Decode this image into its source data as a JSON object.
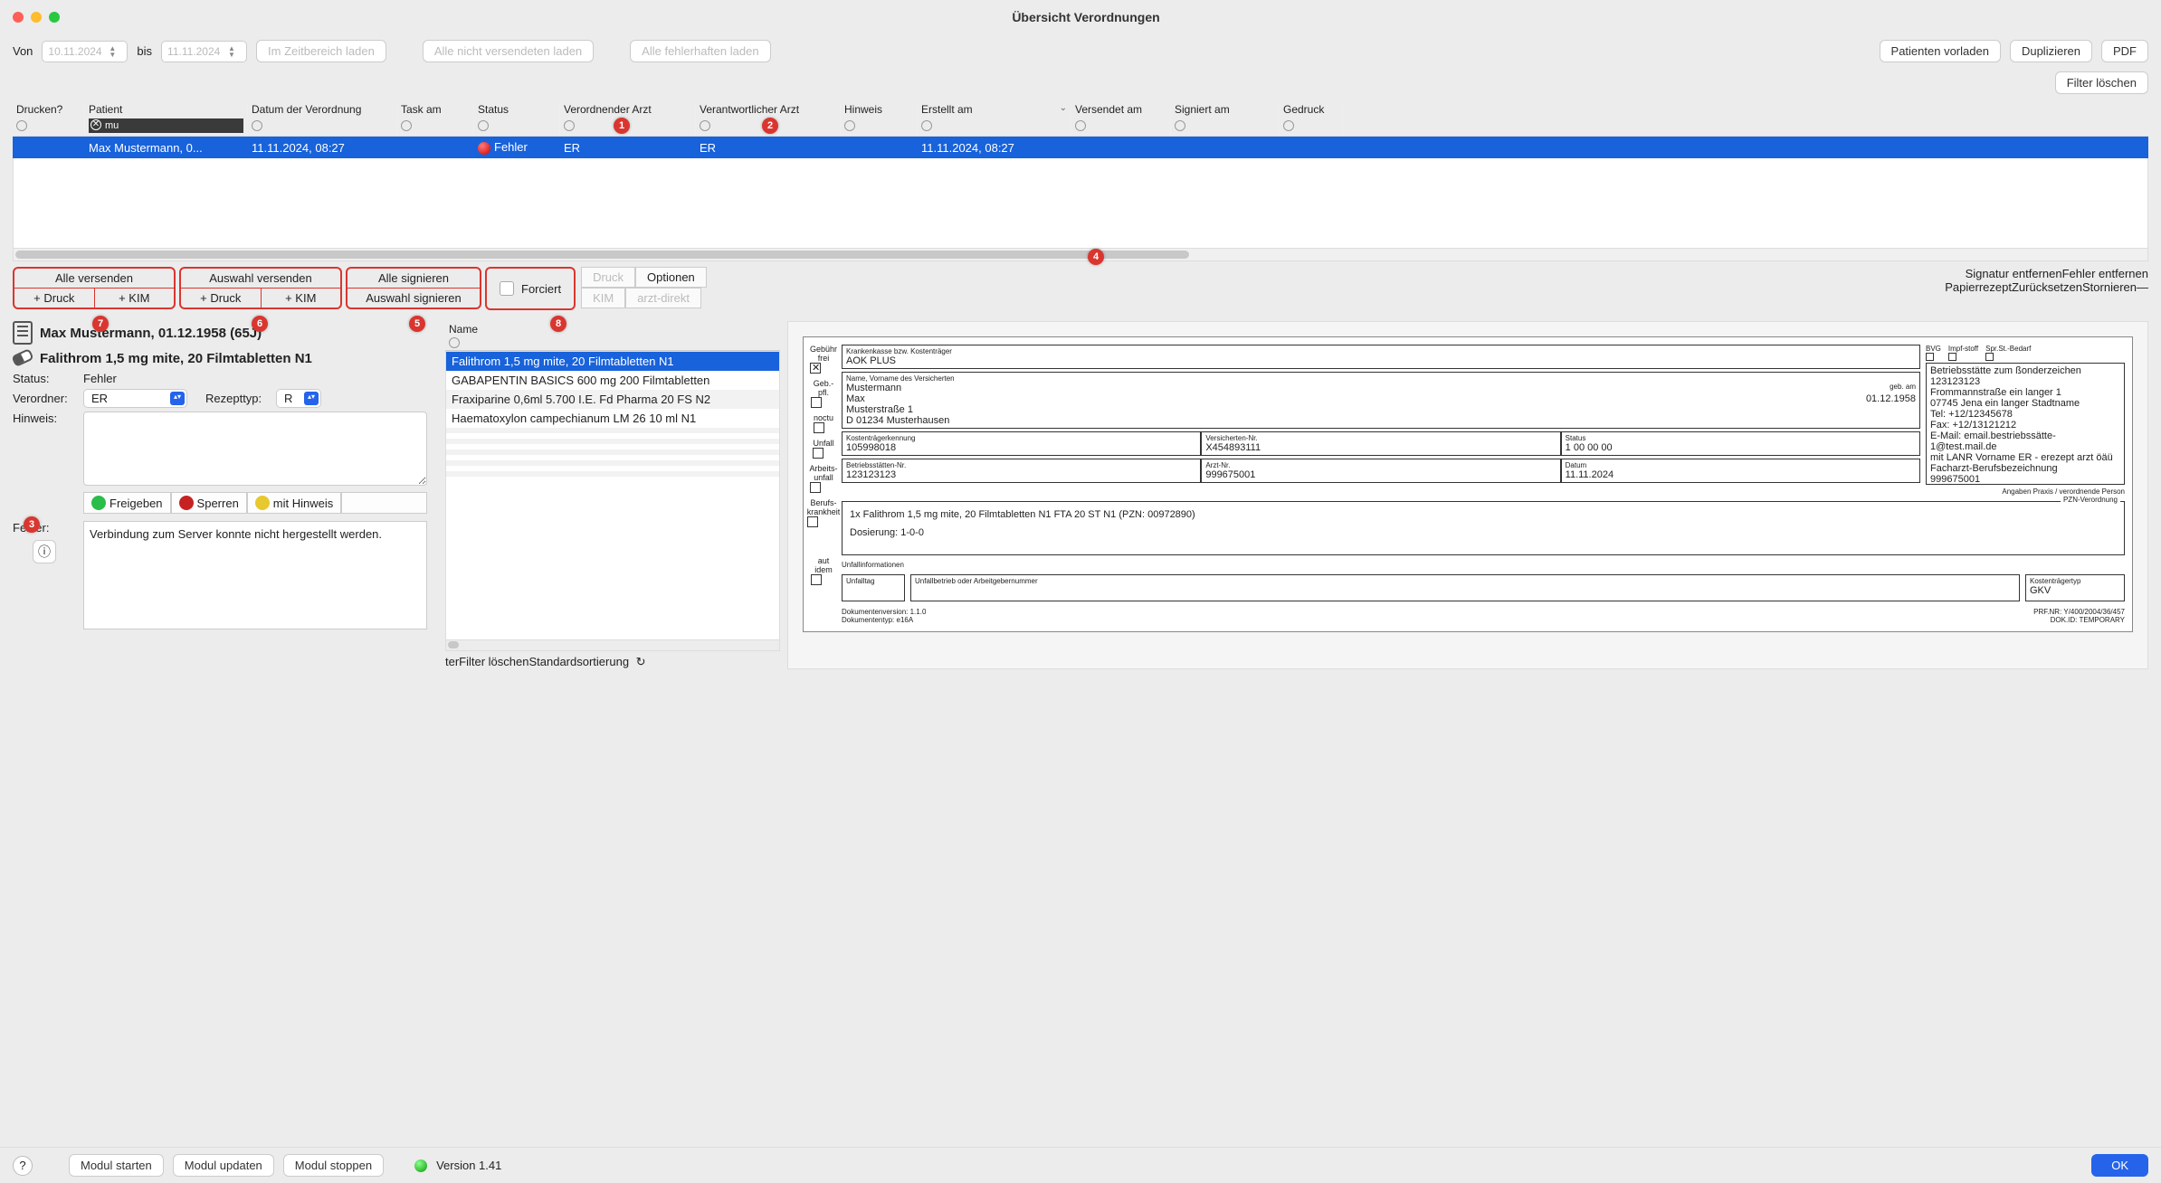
{
  "window": {
    "title": "Übersicht Verordnungen"
  },
  "toolbar": {
    "from_label": "Von",
    "from_value": "10.11.2024",
    "to_label": "bis",
    "to_value": "11.11.2024",
    "load_range": "Im Zeitbereich laden",
    "load_unsent": "Alle nicht versendeten laden",
    "load_errors": "Alle fehlerhaften laden",
    "preload_patients": "Patienten vorladen",
    "duplicate": "Duplizieren",
    "pdf": "PDF",
    "clear_filter": "Filter löschen"
  },
  "callouts": {
    "c1": "1",
    "c2": "2",
    "c3": "3",
    "c4": "4",
    "c5": "5",
    "c6": "6",
    "c7": "7",
    "c8": "8"
  },
  "table": {
    "columns": {
      "print": "Drucken?",
      "patient": "Patient",
      "rx_date": "Datum der Verordnung",
      "task_on": "Task am",
      "status": "Status",
      "prescriber": "Verordnender Arzt",
      "responsible": "Verantwortlicher Arzt",
      "note": "Hinweis",
      "created": "Erstellt am",
      "sent": "Versendet am",
      "signed": "Signiert am",
      "printed": "Gedruck"
    },
    "filter_patient": "mu",
    "row": {
      "patient": "Max Mustermann, 0...",
      "rx_date": "11.11.2024, 08:27",
      "status": "Fehler",
      "prescriber": "ER",
      "responsible": "ER",
      "created": "11.11.2024, 08:27"
    }
  },
  "actions": {
    "send_all": "Alle versenden",
    "send_selection": "Auswahl versenden",
    "sign_all": "Alle signieren",
    "sign_selection": "Auswahl signieren",
    "plus_print": "+ Druck",
    "plus_kim": "+ KIM",
    "forced": "Forciert",
    "print": "Druck",
    "options": "Optionen",
    "kim": "KIM",
    "arzt_direkt": "arzt-direkt",
    "remove_sig": "Signatur entfernen",
    "remove_err": "Fehler entfernen",
    "paper_rx": "Papierrezept",
    "reset": "Zurücksetzen",
    "cancel": "Stornieren",
    "minus": "—"
  },
  "detail": {
    "patient_title": "Max Mustermann, 01.12.1958 (65J)",
    "medication_title": "Falithrom 1,5 mg mite, 20 Filmtabletten N1",
    "status_label": "Status:",
    "status_value": "Fehler",
    "prescriber_label": "Verordner:",
    "prescriber_value": "ER",
    "rx_type_label": "Rezepttyp:",
    "rx_type_value": "R",
    "note_label": "Hinweis:",
    "release": "Freigeben",
    "block": "Sperren",
    "with_note": "mit Hinweis",
    "error_label": "Fehler:",
    "error_text": "Verbindung zum Server konnte nicht hergestellt werden."
  },
  "namelist": {
    "header": "Name",
    "footer_ter": "ter",
    "footer_clear": "Filter löschen",
    "footer_sort": "Standardsortierung",
    "items": [
      "Falithrom 1,5 mg mite, 20 Filmtabletten N1",
      "GABAPENTIN BASICS 600 mg 200 Filmtabletten",
      "Fraxiparine 0,6ml 5.700 I.E. Fd Pharma 20 FS N2",
      "Haematoxylon campechianum LM 26 10 ml N1"
    ]
  },
  "rx": {
    "left_labels": {
      "gebuhr": "Gebühr frei",
      "gebpfl": "Geb.-pfl.",
      "noctu": "noctu",
      "unfall": "Unfall",
      "arbeits": "Arbeits-unfall",
      "berufs": "Berufs-krankheit",
      "aut_idem": "aut idem"
    },
    "kk_lbl": "Krankenkasse bzw. Kostenträger",
    "kk_val": "AOK PLUS",
    "name_lbl": "Name, Vorname des Versicherten",
    "lastname": "Mustermann",
    "firstname": "Max",
    "dob_lbl": "geb. am",
    "dob": "01.12.1958",
    "street": "Musterstraße 1",
    "city": "D 01234 Musterhausen",
    "ktk_lbl": "Kostenträgerkennung",
    "ktk_val": "105998018",
    "vnr_lbl": "Versicherten-Nr.",
    "vnr_val": "X454893111",
    "stat_lbl": "Status",
    "stat_val": "1 00 00 00",
    "bsnr_lbl": "Betriebsstätten-Nr.",
    "bsnr_val": "123123123",
    "lanr_lbl": "Arzt-Nr.",
    "lanr_val": "999675001",
    "date_lbl": "Datum",
    "date_val": "11.11.2024",
    "side_labels": {
      "bvg": "BVG",
      "impf": "Impf-stoff",
      "spr": "Spr.St.-Bedarf"
    },
    "practice_addr": "Betriebsstätte zum ßonderzeichen 123123123\nFrommannstraße ein langer 1\n07745 Jena ein langer Stadtname\nTel: +12/12345678\nFax: +12/13121212\nE-Mail: email.bestriebssätte-1@test.mail.de\nmit LANR Vorname ER - erezept arzt öäü\nFacharzt-Berufsbezeichnung\n999675001",
    "praxis_lbl": "Angaben Praxis / verordnende Person",
    "pzn_lbl": "PZN-Verordnung",
    "med_line": "1x Falithrom 1,5 mg mite, 20 Filmtabletten N1 FTA 20 ST N1 (PZN: 00972890)",
    "dosage": "Dosierung: 1-0-0",
    "unfall_info": "Unfallinformationen",
    "unfalltag": "Unfalltag",
    "unfallbetrieb": "Unfallbetrieb oder Arbeitgebernummer",
    "kosten_typ_lbl": "Kostenträgertyp",
    "kosten_typ_val": "GKV",
    "docver_lbl": "Dokumentenversion:",
    "docver": "1.1.0",
    "doctyp_lbl": "Dokumententyp:",
    "doctyp": "e16A",
    "prfnr_lbl": "PRF.NR:",
    "prfnr": "Y/400/2004/36/457",
    "dokid_lbl": "DOK.ID:",
    "dokid": "TEMPORARY"
  },
  "status": {
    "module_start": "Modul starten",
    "module_update": "Modul updaten",
    "module_stop": "Modul stoppen",
    "version": "Version 1.41",
    "ok": "OK"
  }
}
